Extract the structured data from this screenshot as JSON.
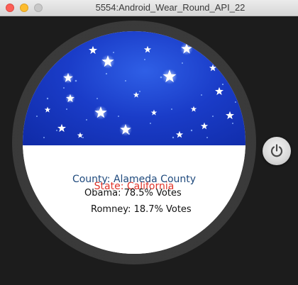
{
  "window": {
    "title": "5554:Android_Wear_Round_API_22"
  },
  "screen": {
    "county_label": "County: Alameda County",
    "state_label": "State: California",
    "obama_line": "Obama: 78.5% Votes",
    "romney_line": "Romney: 18.7% Votes"
  },
  "icons": {
    "close": "close-dot-icon",
    "minimize": "minimize-dot-icon",
    "maximize": "maximize-dot-icon",
    "power": "power-icon",
    "stars": "star-icon"
  },
  "colors": {
    "county_text": "#1f4a7d",
    "state_text": "#e0342a",
    "sky": "#1a3cc8",
    "bezel": "#393939",
    "background": "#1c1c1c"
  }
}
